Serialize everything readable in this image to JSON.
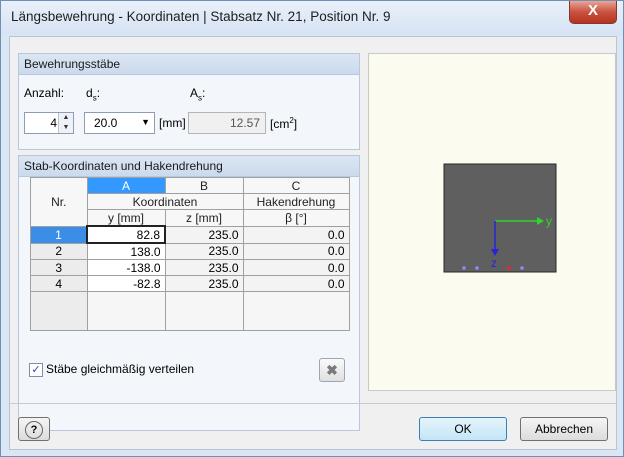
{
  "window": {
    "title": "Längsbewehrung - Koordinaten | Stabsatz Nr. 21, Position Nr. 9",
    "close_glyph": "X"
  },
  "bars_group": {
    "title": "Bewehrungsstäbe",
    "count_label": "Anzahl:",
    "diameter_label_main": "d",
    "diameter_label_sub": "s",
    "diameter_label_colon": ":",
    "area_label_main": "A",
    "area_label_sub": "s",
    "area_label_colon": ":",
    "count_value": "4",
    "diameter_value": "20.0",
    "diameter_unit": "[mm]",
    "area_value": "12.57",
    "area_unit_open": "[cm",
    "area_unit_sup": "2",
    "area_unit_close": "]"
  },
  "coords_group": {
    "title": "Stab-Koordinaten und Hakendrehung",
    "col_letters": [
      "A",
      "B",
      "C"
    ],
    "header_nr": "Nr.",
    "header_koordinaten": "Koordinaten",
    "header_hakendrehung": "Hakendrehung",
    "header_y": "y [mm]",
    "header_z": "z [mm]",
    "header_beta": "β [°]",
    "rows": [
      {
        "nr": "1",
        "y": "82.8",
        "z": "235.0",
        "beta": "0.0"
      },
      {
        "nr": "2",
        "y": "138.0",
        "z": "235.0",
        "beta": "0.0"
      },
      {
        "nr": "3",
        "y": "-138.0",
        "z": "235.0",
        "beta": "0.0"
      },
      {
        "nr": "4",
        "y": "-82.8",
        "z": "235.0",
        "beta": "0.0"
      }
    ],
    "distribute_checkbox_label": "Stäbe gleichmäßig verteilen",
    "distribute_checked": true
  },
  "preview": {
    "axis_y": "y",
    "axis_z": "z",
    "section_color": "#5f5f5f",
    "axis_y_color": "#2fd42f",
    "axis_z_color": "#2424d8",
    "bar_color": "#8b8bff",
    "selected_bar_color": "#ff2020"
  },
  "footer": {
    "ok_label": "OK",
    "cancel_label": "Abbrechen"
  }
}
